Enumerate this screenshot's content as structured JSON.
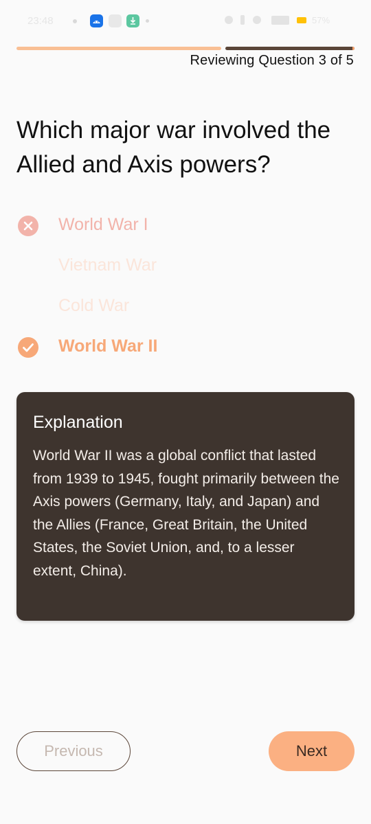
{
  "status_bar": {
    "time": "23:48",
    "battery_text": "57%",
    "icons": [
      "notification-dot-icon",
      "android-app-icon",
      "gallery-icon",
      "download-icon",
      "notification-dot-icon",
      "alarm-icon",
      "bluetooth-icon",
      "mute-icon",
      "signal-icon",
      "battery-icon"
    ],
    "battery_color": "#ffc107"
  },
  "progress": {
    "total": 5,
    "current": 3,
    "label": "Reviewing Question 3 of 5"
  },
  "question": {
    "text": "Which major war involved the Allied and Axis powers?"
  },
  "options": [
    {
      "label": "World War I",
      "state": "wrong",
      "icon": "x-circle-icon"
    },
    {
      "label": "Vietnam War",
      "state": "neutral"
    },
    {
      "label": "Cold War",
      "state": "neutral"
    },
    {
      "label": "World War II",
      "state": "correct",
      "icon": "check-circle-icon"
    }
  ],
  "explanation": {
    "title": "Explanation",
    "body": "World War II was a global conflict that lasted from 1939 to 1945, fought primarily between the Axis powers (Germany, Italy, and Japan) and the Allies (France, Great Britain, the United States, the Soviet Union, and, to a lesser extent, China)."
  },
  "buttons": {
    "previous_label": "Previous",
    "next_label": "Next"
  },
  "colors": {
    "accent": "#f7a878",
    "wrong": "#f2b3aa",
    "dark_brown": "#3e342e",
    "next_button": "#fbb082"
  }
}
